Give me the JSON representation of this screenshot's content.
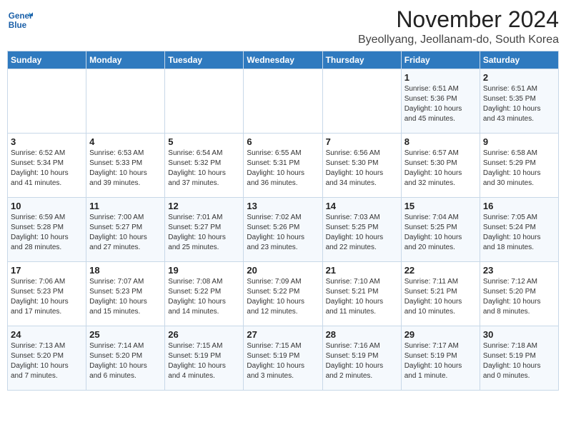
{
  "logo": {
    "line1": "General",
    "line2": "Blue"
  },
  "title": "November 2024",
  "location": "Byeollyang, Jeollanam-do, South Korea",
  "weekdays": [
    "Sunday",
    "Monday",
    "Tuesday",
    "Wednesday",
    "Thursday",
    "Friday",
    "Saturday"
  ],
  "weeks": [
    [
      {
        "day": "",
        "info": ""
      },
      {
        "day": "",
        "info": ""
      },
      {
        "day": "",
        "info": ""
      },
      {
        "day": "",
        "info": ""
      },
      {
        "day": "",
        "info": ""
      },
      {
        "day": "1",
        "info": "Sunrise: 6:51 AM\nSunset: 5:36 PM\nDaylight: 10 hours\nand 45 minutes."
      },
      {
        "day": "2",
        "info": "Sunrise: 6:51 AM\nSunset: 5:35 PM\nDaylight: 10 hours\nand 43 minutes."
      }
    ],
    [
      {
        "day": "3",
        "info": "Sunrise: 6:52 AM\nSunset: 5:34 PM\nDaylight: 10 hours\nand 41 minutes."
      },
      {
        "day": "4",
        "info": "Sunrise: 6:53 AM\nSunset: 5:33 PM\nDaylight: 10 hours\nand 39 minutes."
      },
      {
        "day": "5",
        "info": "Sunrise: 6:54 AM\nSunset: 5:32 PM\nDaylight: 10 hours\nand 37 minutes."
      },
      {
        "day": "6",
        "info": "Sunrise: 6:55 AM\nSunset: 5:31 PM\nDaylight: 10 hours\nand 36 minutes."
      },
      {
        "day": "7",
        "info": "Sunrise: 6:56 AM\nSunset: 5:30 PM\nDaylight: 10 hours\nand 34 minutes."
      },
      {
        "day": "8",
        "info": "Sunrise: 6:57 AM\nSunset: 5:30 PM\nDaylight: 10 hours\nand 32 minutes."
      },
      {
        "day": "9",
        "info": "Sunrise: 6:58 AM\nSunset: 5:29 PM\nDaylight: 10 hours\nand 30 minutes."
      }
    ],
    [
      {
        "day": "10",
        "info": "Sunrise: 6:59 AM\nSunset: 5:28 PM\nDaylight: 10 hours\nand 28 minutes."
      },
      {
        "day": "11",
        "info": "Sunrise: 7:00 AM\nSunset: 5:27 PM\nDaylight: 10 hours\nand 27 minutes."
      },
      {
        "day": "12",
        "info": "Sunrise: 7:01 AM\nSunset: 5:27 PM\nDaylight: 10 hours\nand 25 minutes."
      },
      {
        "day": "13",
        "info": "Sunrise: 7:02 AM\nSunset: 5:26 PM\nDaylight: 10 hours\nand 23 minutes."
      },
      {
        "day": "14",
        "info": "Sunrise: 7:03 AM\nSunset: 5:25 PM\nDaylight: 10 hours\nand 22 minutes."
      },
      {
        "day": "15",
        "info": "Sunrise: 7:04 AM\nSunset: 5:25 PM\nDaylight: 10 hours\nand 20 minutes."
      },
      {
        "day": "16",
        "info": "Sunrise: 7:05 AM\nSunset: 5:24 PM\nDaylight: 10 hours\nand 18 minutes."
      }
    ],
    [
      {
        "day": "17",
        "info": "Sunrise: 7:06 AM\nSunset: 5:23 PM\nDaylight: 10 hours\nand 17 minutes."
      },
      {
        "day": "18",
        "info": "Sunrise: 7:07 AM\nSunset: 5:23 PM\nDaylight: 10 hours\nand 15 minutes."
      },
      {
        "day": "19",
        "info": "Sunrise: 7:08 AM\nSunset: 5:22 PM\nDaylight: 10 hours\nand 14 minutes."
      },
      {
        "day": "20",
        "info": "Sunrise: 7:09 AM\nSunset: 5:22 PM\nDaylight: 10 hours\nand 12 minutes."
      },
      {
        "day": "21",
        "info": "Sunrise: 7:10 AM\nSunset: 5:21 PM\nDaylight: 10 hours\nand 11 minutes."
      },
      {
        "day": "22",
        "info": "Sunrise: 7:11 AM\nSunset: 5:21 PM\nDaylight: 10 hours\nand 10 minutes."
      },
      {
        "day": "23",
        "info": "Sunrise: 7:12 AM\nSunset: 5:20 PM\nDaylight: 10 hours\nand 8 minutes."
      }
    ],
    [
      {
        "day": "24",
        "info": "Sunrise: 7:13 AM\nSunset: 5:20 PM\nDaylight: 10 hours\nand 7 minutes."
      },
      {
        "day": "25",
        "info": "Sunrise: 7:14 AM\nSunset: 5:20 PM\nDaylight: 10 hours\nand 6 minutes."
      },
      {
        "day": "26",
        "info": "Sunrise: 7:15 AM\nSunset: 5:19 PM\nDaylight: 10 hours\nand 4 minutes."
      },
      {
        "day": "27",
        "info": "Sunrise: 7:15 AM\nSunset: 5:19 PM\nDaylight: 10 hours\nand 3 minutes."
      },
      {
        "day": "28",
        "info": "Sunrise: 7:16 AM\nSunset: 5:19 PM\nDaylight: 10 hours\nand 2 minutes."
      },
      {
        "day": "29",
        "info": "Sunrise: 7:17 AM\nSunset: 5:19 PM\nDaylight: 10 hours\nand 1 minute."
      },
      {
        "day": "30",
        "info": "Sunrise: 7:18 AM\nSunset: 5:19 PM\nDaylight: 10 hours\nand 0 minutes."
      }
    ]
  ]
}
